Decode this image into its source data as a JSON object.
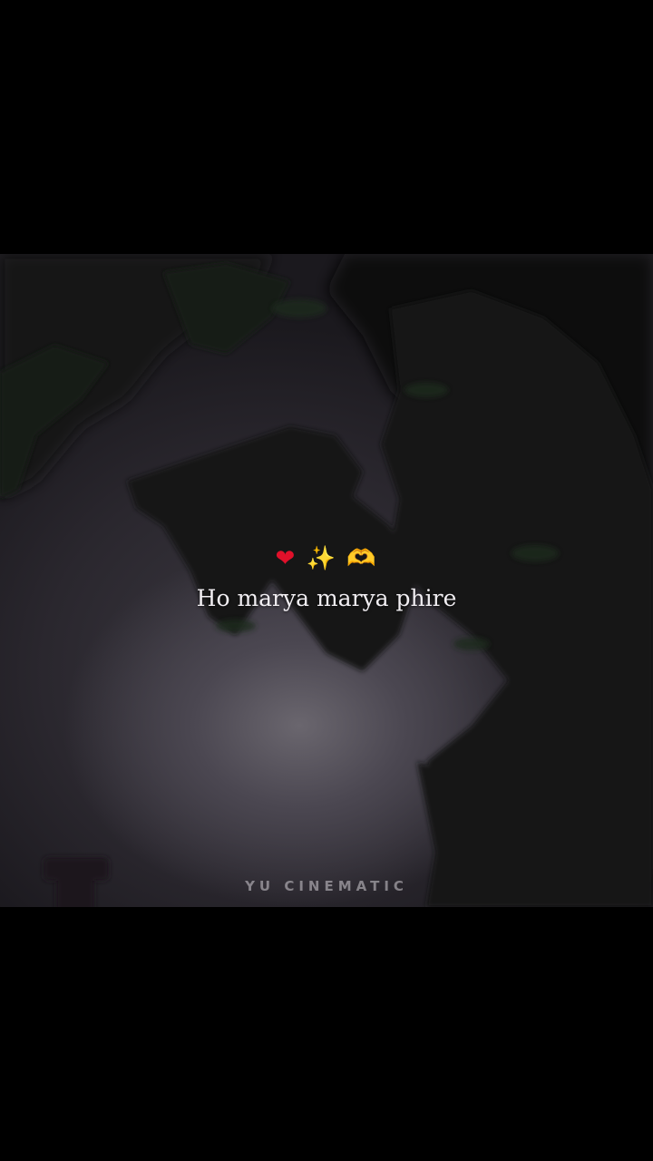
{
  "video": {
    "emojis": [
      "❤",
      "✨",
      "🫶"
    ],
    "lyric_text": "Ho marya marya phire",
    "watermark_text": "YU CINEMATIC",
    "scene": "night sky with tree silhouette"
  },
  "colors": {
    "background": "#000000",
    "lyric": "#f1eef2",
    "watermark": "#d2cdd4",
    "heart": "#e0102a",
    "sparkle": "#f2c23a"
  }
}
